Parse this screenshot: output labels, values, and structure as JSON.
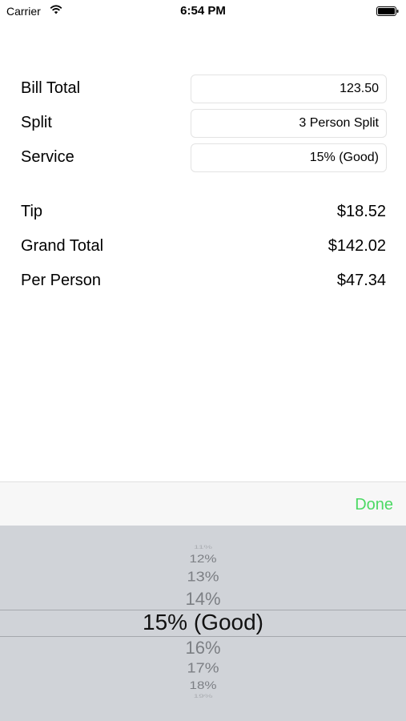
{
  "status_bar": {
    "carrier": "Carrier",
    "time": "6:54 PM"
  },
  "form": {
    "bill_total": {
      "label": "Bill Total",
      "value": "123.50"
    },
    "split": {
      "label": "Split",
      "value": "3 Person Split"
    },
    "service": {
      "label": "Service",
      "value": "15% (Good)"
    }
  },
  "results": {
    "tip": {
      "label": "Tip",
      "value": "$18.52"
    },
    "grand_total": {
      "label": "Grand Total",
      "value": "$142.02"
    },
    "per_person": {
      "label": "Per Person",
      "value": "$47.34"
    }
  },
  "toolbar": {
    "done_label": "Done",
    "done_color": "#4cd964"
  },
  "picker": {
    "items": [
      "11%",
      "12%",
      "13%",
      "14%",
      "15% (Good)",
      "16%",
      "17%",
      "18%",
      "19%"
    ],
    "selected": "15% (Good)"
  }
}
